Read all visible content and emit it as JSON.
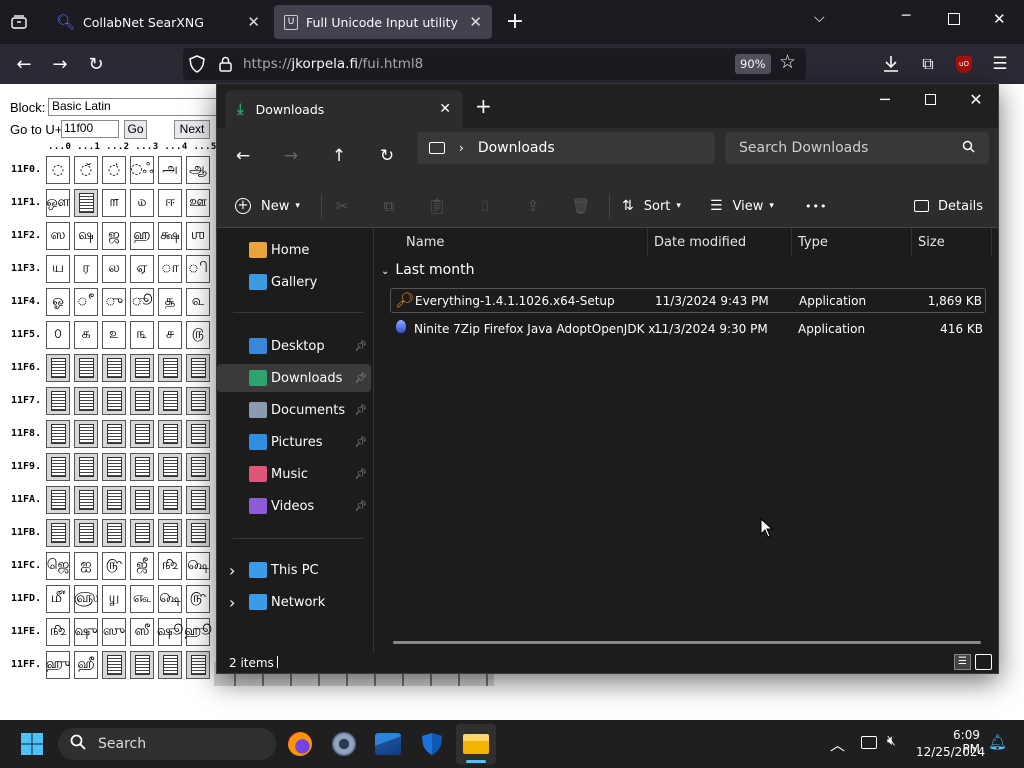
{
  "browser": {
    "tabs": [
      {
        "title": "CollabNet SearXNG",
        "active": false
      },
      {
        "title": "Full Unicode Input utility",
        "active": true
      }
    ],
    "new_tab": "+",
    "url_prefix": "https://",
    "url_domain": "jkorpela.fi",
    "url_path": "/fui.html8",
    "zoom": "90%"
  },
  "webpage": {
    "block_label": "Block:",
    "block_value": "Basic Latin",
    "goto_label": "Go to U+",
    "goto_value": "11f00",
    "go_button": "Go",
    "next_button": "Next",
    "header_row": "...0 ...1 ...2 ...3 ...4 ...5",
    "row_labels": [
      "11F0.",
      "11F1.",
      "11F2.",
      "11F3.",
      "11F4.",
      "11F5.",
      "11F6.",
      "11F7.",
      "11F8.",
      "11F9.",
      "11FA.",
      "11FB.",
      "11FC.",
      "11FD.",
      "11FE.",
      "11FF."
    ],
    "glyph_rows": [
      [
        "◌",
        "◌̆",
        "◌̇",
        "◌ஃ",
        "அ",
        "ஆ"
      ],
      [
        "ஔ",
        "box",
        "௱",
        "௰",
        "ஈ",
        "ஊ"
      ],
      [
        "ஸ",
        "ஷ",
        "ஜ",
        "ஹ",
        "க்ஷ",
        "ஶ"
      ],
      [
        "ய",
        "ர",
        "ல",
        "ஏ",
        "ா",
        "ி"
      ],
      [
        "ஓ",
        "ீ",
        "ு",
        "ூ",
        "௲",
        "௳"
      ],
      [
        "௦",
        "௧",
        "௨",
        "௩",
        "௪",
        "௫"
      ],
      [
        "box",
        "box",
        "box",
        "box",
        "box",
        "box"
      ],
      [
        "box",
        "box",
        "box",
        "box",
        "box",
        "box"
      ],
      [
        "box",
        "box",
        "box",
        "box",
        "box",
        "box"
      ],
      [
        "box",
        "box",
        "box",
        "box",
        "box",
        "box"
      ],
      [
        "box",
        "box",
        "box",
        "box",
        "box",
        "box"
      ],
      [
        "box",
        "box",
        "box",
        "box",
        "box",
        "box"
      ],
      [
        "ஜெ",
        "ஐ",
        "௹",
        "ஜீ",
        "௺",
        "௸"
      ],
      [
        "௴",
        "௵",
        "௶",
        "௷",
        "௸",
        "௹"
      ],
      [
        "௺",
        "ஷு",
        "ஸு",
        "ஸீ",
        "ஷூ",
        "ஹூ"
      ],
      [
        "ஹு",
        "ஹீ",
        "box",
        "box",
        "box",
        "box"
      ]
    ]
  },
  "explorer": {
    "tab_title": "Downloads",
    "new_tab": "+",
    "breadcrumb": "Downloads",
    "search_placeholder": "Search Downloads",
    "toolbar": {
      "new": "New",
      "sort": "Sort",
      "view": "View",
      "more": "•••",
      "details": "Details"
    },
    "nav": [
      {
        "label": "Home",
        "icon": "home-icon",
        "color": "#e8a33d"
      },
      {
        "label": "Gallery",
        "icon": "gallery-icon",
        "color": "#3b9ae1"
      },
      {
        "label": "Desktop",
        "icon": "desktop-icon",
        "color": "#3a87d9",
        "pinned": true
      },
      {
        "label": "Downloads",
        "icon": "downloads-icon",
        "color": "#2ea36e",
        "pinned": true,
        "selected": true
      },
      {
        "label": "Documents",
        "icon": "documents-icon",
        "color": "#8a9bb0",
        "pinned": true
      },
      {
        "label": "Pictures",
        "icon": "pictures-icon",
        "color": "#2f8ee0",
        "pinned": true
      },
      {
        "label": "Music",
        "icon": "music-icon",
        "color": "#e0557a",
        "pinned": true
      },
      {
        "label": "Videos",
        "icon": "videos-icon",
        "color": "#8c5bd6",
        "pinned": true
      },
      {
        "label": "This PC",
        "icon": "this-pc-icon",
        "color": "#3a9be8"
      },
      {
        "label": "Network",
        "icon": "network-icon",
        "color": "#3a9be8"
      }
    ],
    "columns": [
      "Name",
      "Date modified",
      "Type",
      "Size"
    ],
    "group_label": "Last month",
    "files": [
      {
        "name": "Everything-1.4.1.1026.x64-Setup",
        "date": "11/3/2024 9:43 PM",
        "type": "Application",
        "size": "1,869 KB"
      },
      {
        "name": "Ninite 7Zip Firefox Java AdoptOpenJDK x...",
        "date": "11/3/2024 9:30 PM",
        "type": "Application",
        "size": "416 KB"
      }
    ],
    "status": "2 items"
  },
  "taskbar": {
    "search_label": "Search",
    "time": "6:09 PM",
    "date": "12/25/2024"
  }
}
